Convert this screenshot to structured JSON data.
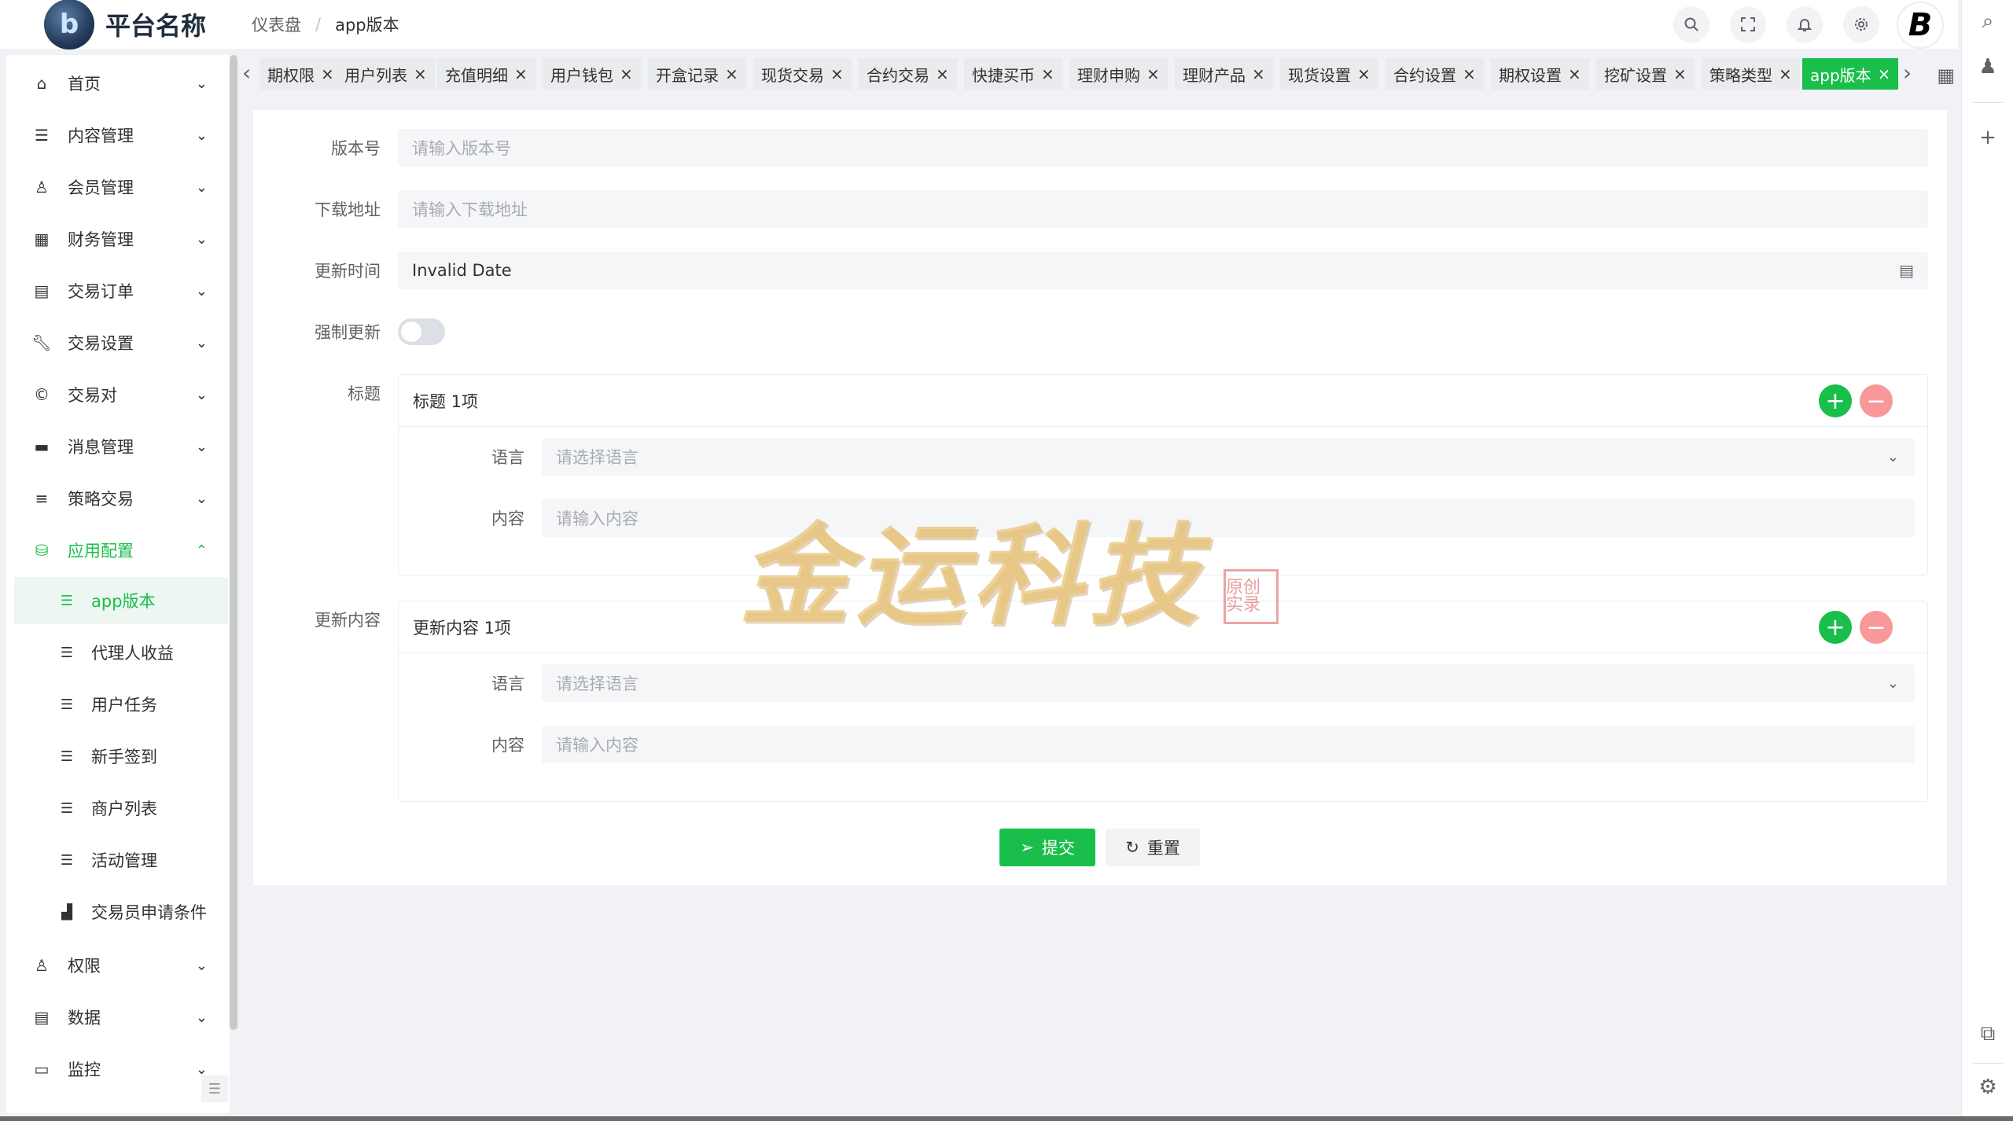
{
  "header": {
    "platform_name": "平台名称",
    "breadcrumb_home": "仪表盘",
    "breadcrumb_sep": "/",
    "breadcrumb_current": "app版本",
    "avatar_letter": "B"
  },
  "sidebar": {
    "items": [
      {
        "label": "首页",
        "icon": "home-icon"
      },
      {
        "label": "内容管理",
        "icon": "list-icon"
      },
      {
        "label": "会员管理",
        "icon": "user-icon"
      },
      {
        "label": "财务管理",
        "icon": "ledger-icon"
      },
      {
        "label": "交易订单",
        "icon": "table-icon"
      },
      {
        "label": "交易设置",
        "icon": "wrench-icon"
      },
      {
        "label": "交易对",
        "icon": "copyright-icon"
      },
      {
        "label": "消息管理",
        "icon": "message-icon"
      },
      {
        "label": "策略交易",
        "icon": "menu-icon"
      },
      {
        "label": "应用配置",
        "icon": "database-icon"
      }
    ],
    "sub_items": [
      {
        "label": "app版本"
      },
      {
        "label": "代理人收益"
      },
      {
        "label": "用户任务"
      },
      {
        "label": "新手签到"
      },
      {
        "label": "商户列表"
      },
      {
        "label": "活动管理"
      },
      {
        "label": "交易员申请条件"
      }
    ],
    "bottom_items": [
      {
        "label": "权限",
        "icon": "user-lock-icon"
      },
      {
        "label": "数据",
        "icon": "data-icon"
      },
      {
        "label": "监控",
        "icon": "monitor-icon"
      }
    ]
  },
  "tabs": [
    {
      "label": "期权限"
    },
    {
      "label": "用户列表"
    },
    {
      "label": "充值明细"
    },
    {
      "label": "用户钱包"
    },
    {
      "label": "开盒记录"
    },
    {
      "label": "现货交易"
    },
    {
      "label": "合约交易"
    },
    {
      "label": "快捷买币"
    },
    {
      "label": "理财申购"
    },
    {
      "label": "理财产品"
    },
    {
      "label": "现货设置"
    },
    {
      "label": "合约设置"
    },
    {
      "label": "期权设置"
    },
    {
      "label": "挖矿设置"
    },
    {
      "label": "策略类型"
    },
    {
      "label": "app版本"
    }
  ],
  "form": {
    "version_label": "版本号",
    "version_placeholder": "请输入版本号",
    "download_label": "下载地址",
    "download_placeholder": "请输入下载地址",
    "update_time_label": "更新时间",
    "update_time_value": "Invalid Date",
    "force_update_label": "强制更新",
    "force_update_on": false,
    "title_label": "标题",
    "title_card_head": "标题 1项",
    "update_content_label": "更新内容",
    "update_card_head": "更新内容 1项",
    "language_label": "语言",
    "language_placeholder": "请选择语言",
    "content_label": "内容",
    "content_placeholder": "请输入内容",
    "submit_label": "提交",
    "reset_label": "重置"
  },
  "watermark": {
    "text": "金运科技",
    "seal_text": "原创实录"
  },
  "colors": {
    "accent": "#19be4b",
    "minus": "#f89898"
  }
}
